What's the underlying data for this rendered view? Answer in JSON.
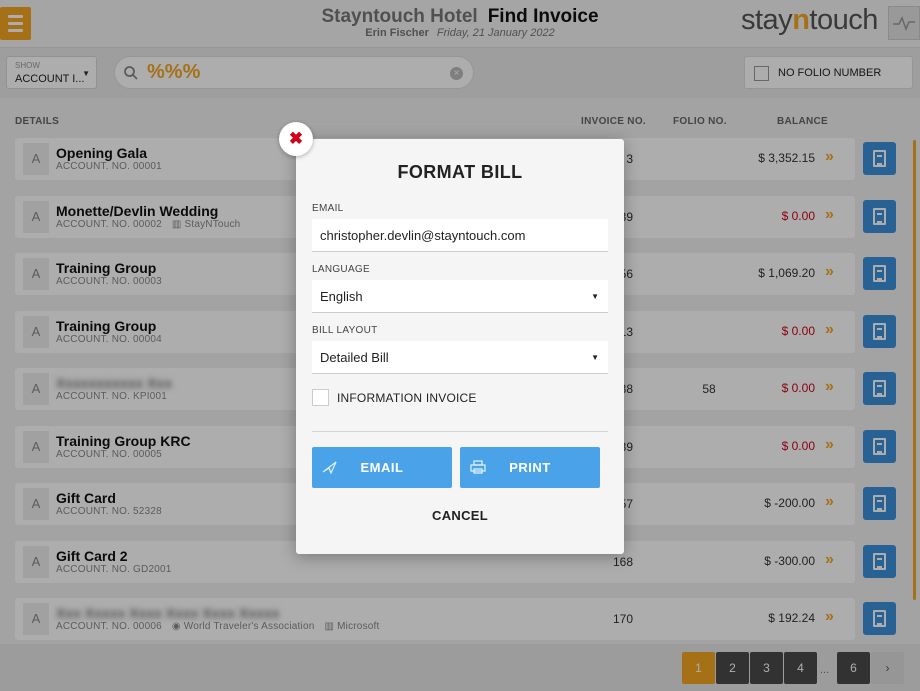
{
  "header": {
    "hotel": "Stayntouch Hotel",
    "page_title": "Find Invoice",
    "user": "Erin Fischer",
    "date": "Friday, 21 January 2022",
    "logo_pre": "stay",
    "logo_n": "n",
    "logo_post": "touch"
  },
  "filters": {
    "show_label": "SHOW",
    "show_value": "ACCOUNT I...",
    "search_value": "%%%",
    "no_folio_label": "NO FOLIO NUMBER"
  },
  "columns": {
    "details": "DETAILS",
    "invoice_no": "INVOICE NO.",
    "folio_no": "FOLIO NO.",
    "balance": "BALANCE"
  },
  "rows": [
    {
      "type": "A",
      "name": "Opening Gala",
      "account": "ACCOUNT. NO. 00001",
      "extra": "",
      "extra2": "",
      "invoice": "3",
      "folio": "",
      "balance": "$ 3,352.15",
      "zero": false
    },
    {
      "type": "A",
      "name": "Monette/Devlin Wedding",
      "account": "ACCOUNT. NO. 00002",
      "extra": "StayNTouch",
      "extra2": "",
      "invoice": "39",
      "folio": "",
      "balance": "$ 0.00",
      "zero": true
    },
    {
      "type": "A",
      "name": "Training Group",
      "account": "ACCOUNT. NO. 00003",
      "extra": "",
      "extra2": "",
      "invoice": "56",
      "folio": "",
      "balance": "$ 1,069.20",
      "zero": false
    },
    {
      "type": "A",
      "name": "Training Group",
      "account": "ACCOUNT. NO. 00004",
      "extra": "",
      "extra2": "",
      "invoice": "13",
      "folio": "",
      "balance": "$ 0.00",
      "zero": true
    },
    {
      "type": "A",
      "name": "",
      "account": "ACCOUNT. NO. KPI001",
      "extra": "",
      "extra2": "",
      "invoice": "38",
      "folio": "58",
      "balance": "$ 0.00",
      "zero": true
    },
    {
      "type": "A",
      "name": "Training Group KRC",
      "account": "ACCOUNT. NO. 00005",
      "extra": "",
      "extra2": "",
      "invoice": "39",
      "folio": "",
      "balance": "$ 0.00",
      "zero": true
    },
    {
      "type": "A",
      "name": "Gift Card",
      "account": "ACCOUNT. NO. 52328",
      "extra": "",
      "extra2": "",
      "invoice": "57",
      "folio": "",
      "balance": "$ -200.00",
      "zero": false
    },
    {
      "type": "A",
      "name": "Gift Card 2",
      "account": "ACCOUNT. NO. GD2001",
      "extra": "",
      "extra2": "",
      "invoice": "168",
      "folio": "",
      "balance": "$ -300.00",
      "zero": false
    },
    {
      "type": "A",
      "name": "",
      "account": "ACCOUNT. NO. 00006",
      "extra": "World Traveler's Association",
      "extra2": "Microsoft",
      "invoice": "170",
      "folio": "",
      "balance": "$ 192.24",
      "zero": false
    }
  ],
  "pagination": {
    "pages": [
      "1",
      "2",
      "3",
      "4",
      "6"
    ],
    "active": "1",
    "dots": "...",
    "next": "›"
  },
  "modal": {
    "close": "✖",
    "title": "FORMAT BILL",
    "email_label": "EMAIL",
    "email_value": "christopher.devlin@stayntouch.com",
    "language_label": "LANGUAGE",
    "language_value": "English",
    "layout_label": "BILL LAYOUT",
    "layout_value": "Detailed Bill",
    "info_invoice_label": "INFORMATION INVOICE",
    "email_button": "EMAIL",
    "print_button": "PRINT",
    "cancel_button": "CANCEL"
  },
  "colors": {
    "accent": "#f5a623",
    "primary_button": "#4aa3e8",
    "bill_button": "#3b8fd9",
    "zero_balance": "#d0021b"
  }
}
